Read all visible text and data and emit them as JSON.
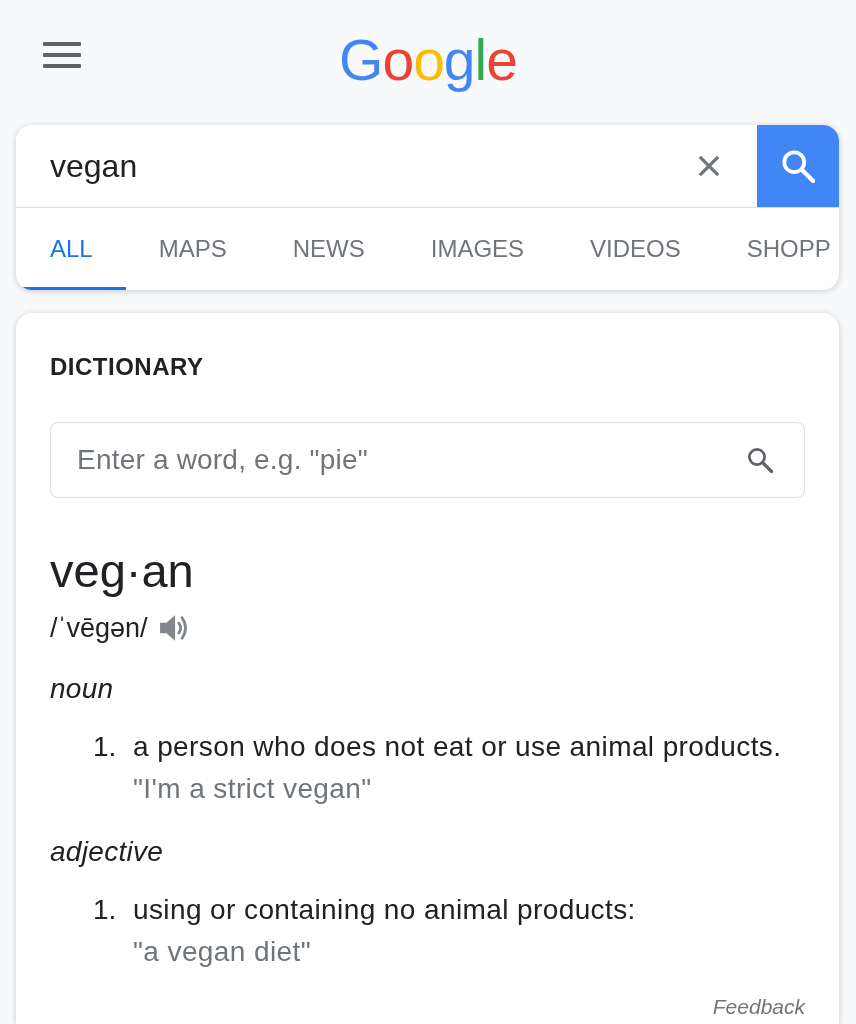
{
  "header": {
    "logo": "Google"
  },
  "search": {
    "value": "vegan"
  },
  "tabs": [
    {
      "label": "ALL",
      "selected": true
    },
    {
      "label": "MAPS",
      "selected": false
    },
    {
      "label": "NEWS",
      "selected": false
    },
    {
      "label": "IMAGES",
      "selected": false
    },
    {
      "label": "VIDEOS",
      "selected": false
    },
    {
      "label": "SHOPP",
      "selected": false
    }
  ],
  "dictionary": {
    "heading": "DICTIONARY",
    "search": {
      "placeholder": "Enter a word, e.g. \"pie\""
    },
    "word": "veg·an",
    "pronunciation": "/ˈvēgən/",
    "senses": [
      {
        "part_of_speech": "noun",
        "definitions": [
          {
            "number": "1.",
            "text": "a person who does not eat or use animal products.",
            "example": "\"I'm a strict vegan\""
          }
        ]
      },
      {
        "part_of_speech": "adjective",
        "definitions": [
          {
            "number": "1.",
            "text": "using or containing no animal products:",
            "example": "\"a vegan diet\""
          }
        ]
      }
    ],
    "feedback": "Feedback"
  }
}
